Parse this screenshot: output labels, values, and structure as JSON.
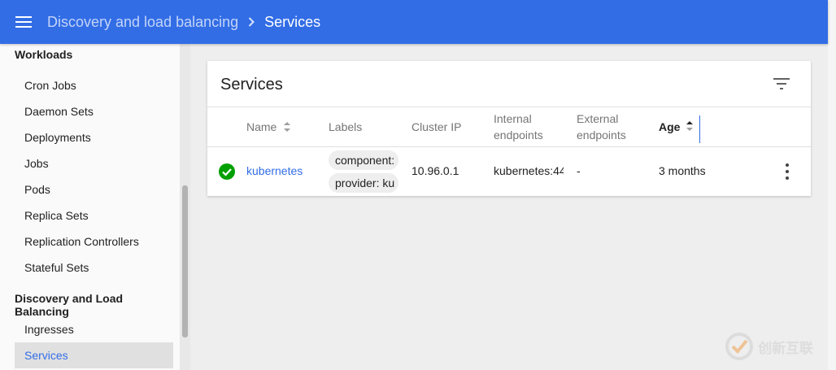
{
  "header": {
    "breadcrumb_parent": "Discovery and load balancing",
    "breadcrumb_current": "Services"
  },
  "sidebar": {
    "sections": [
      {
        "heading": "Workloads",
        "items": [
          "Cron Jobs",
          "Daemon Sets",
          "Deployments",
          "Jobs",
          "Pods",
          "Replica Sets",
          "Replication Controllers",
          "Stateful Sets"
        ]
      },
      {
        "heading": "Discovery and Load Balancing",
        "items": [
          "Ingresses",
          "Services"
        ]
      }
    ],
    "active_item": "Services"
  },
  "card": {
    "title": "Services"
  },
  "table": {
    "columns": {
      "name": "Name",
      "labels": "Labels",
      "cluster_ip": "Cluster IP",
      "internal_endpoints": [
        "Internal",
        "endpoints"
      ],
      "external_endpoints": [
        "External",
        "endpoints"
      ],
      "age": "Age"
    },
    "sorted_by": "Age",
    "rows": [
      {
        "status": "running",
        "name": "kubernetes",
        "labels": [
          "component:",
          "provider: ku"
        ],
        "cluster_ip": "10.96.0.1",
        "internal_endpoints": "kubernetes:44",
        "external_endpoints": "-",
        "age": "3 months"
      }
    ]
  },
  "watermark": {
    "text": "创新互联"
  },
  "colors": {
    "brand": "#326de6",
    "success": "#00a000"
  },
  "icons": [
    "menu-icon",
    "chevron-right-icon",
    "filter-icon",
    "sort-icon",
    "check-circle-icon",
    "more-vert-icon"
  ]
}
